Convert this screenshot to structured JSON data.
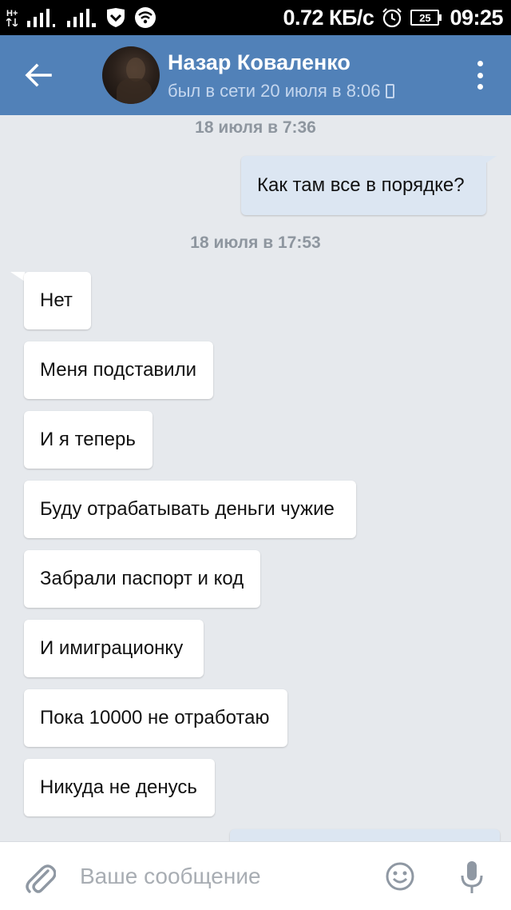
{
  "status_bar": {
    "network_type": "H+",
    "data_speed": "0.72 КБ/с",
    "battery_level": "25",
    "time": "09:25"
  },
  "header": {
    "contact_name": "Назар Коваленко",
    "contact_status": "был в сети 20 июля в 8:06"
  },
  "messages": {
    "date_1": "18 июля в 7:36",
    "outgoing_1": "Как там все в порядке?",
    "date_2": "18 июля в 17:53",
    "incoming": [
      "Нет",
      "Меня подставили",
      "И я теперь",
      "Буду отрабатывать деньги чужие",
      "Забрали паспорт и код",
      "И имиграционку",
      "Пока 10000 не отработаю",
      "Никуда не денусь"
    ]
  },
  "composer": {
    "placeholder": "Ваше сообщение"
  },
  "colors": {
    "header_bg": "#5181b8",
    "chat_bg": "#e6e9ed",
    "outgoing_bubble": "#dce6f2",
    "incoming_bubble": "#ffffff"
  }
}
